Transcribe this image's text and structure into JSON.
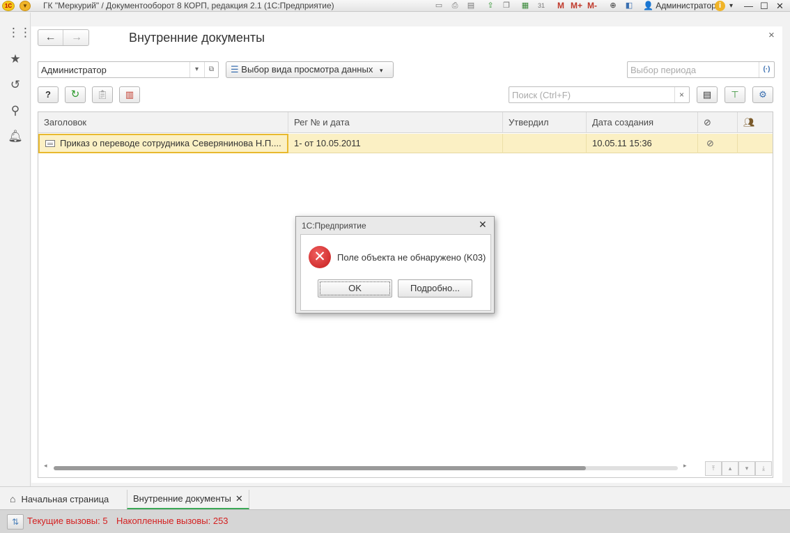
{
  "titlebar": {
    "app_logo": "1С",
    "window_title": "ГК \"Меркурий\" / Документооборот 8 КОРП, редакция 2.1  (1С:Предприятие)",
    "mem_m": "M",
    "mem_m_plus": "M+",
    "mem_m_minus": "M-",
    "user_name": "Администратор",
    "icons": [
      "save-icon",
      "print-icon",
      "preview-icon",
      "upload-icon",
      "copy-icon",
      "calculator-icon",
      "calendar-icon",
      "zoom-icon",
      "panel-icon",
      "user-icon",
      "info-icon",
      "minimize-icon",
      "maximize-icon",
      "close-icon"
    ]
  },
  "leftpanel": {
    "items": [
      "menu-grid-icon",
      "favorites-star-icon",
      "history-icon",
      "search-icon",
      "notifications-bell-icon"
    ]
  },
  "form": {
    "title": "Внутренние документы",
    "close": "×"
  },
  "filters": {
    "user_value": "Администратор",
    "view_button_label": "Выбор вида просмотра данных",
    "period_placeholder": "Выбор периода"
  },
  "toolbar": {
    "help_label": "?",
    "search_placeholder": "Поиск (Ctrl+F)",
    "search_clear": "×"
  },
  "table": {
    "columns": [
      "Заголовок",
      "Рег № и дата",
      "Утвердил",
      "Дата создания"
    ],
    "rows": [
      {
        "title": "Приказ о переводе сотрудника Северянинова Н.П....",
        "reg": "1- от 10.05.2011",
        "approved": "",
        "created": "10.05.11  15:36"
      }
    ]
  },
  "dialog": {
    "title": "1С:Предприятие",
    "message": "Поле объекта не обнаружено (K03)",
    "ok_label": "OK",
    "details_label": "Подробно..."
  },
  "tabs": {
    "home_label": "Начальная страница",
    "active_label": "Внутренние документы"
  },
  "status": {
    "current_calls": "Текущие вызовы: 5",
    "accumulated_calls": "Накопленные вызовы: 253"
  },
  "colors": {
    "selected_row": "#fbf0c4",
    "error_red": "#d42020",
    "accent_green": "#3aa856"
  }
}
